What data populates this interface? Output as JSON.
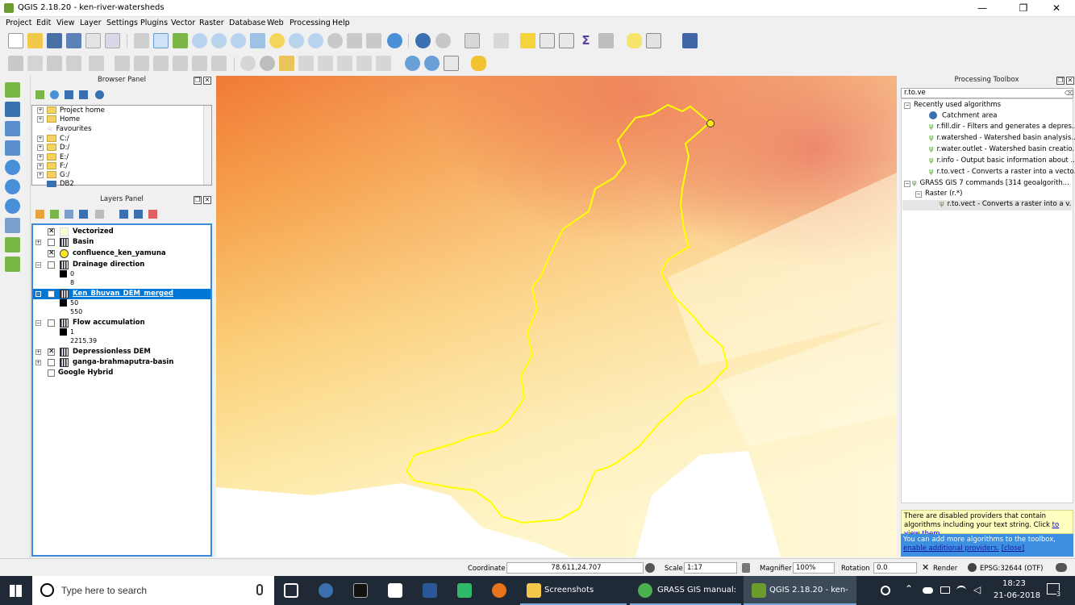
{
  "window": {
    "title": "QGIS 2.18.20 - ken-river-watersheds",
    "min": "—",
    "max": "❐",
    "close": "✕"
  },
  "menu": [
    "Project",
    "Edit",
    "View",
    "Layer",
    "Settings",
    "Plugins",
    "Vector",
    "Raster",
    "Database",
    "Web",
    "Processing",
    "Help"
  ],
  "browser": {
    "title": "Browser Panel",
    "items": [
      "Project home",
      "Home",
      "Favourites",
      "C:/",
      "D:/",
      "E:/",
      "F:/",
      "G:/",
      "DB2"
    ]
  },
  "layers": {
    "title": "Layers Panel",
    "rows": [
      {
        "name": "Vectorized",
        "checked": "✕"
      },
      {
        "name": "Basin",
        "checked": ""
      },
      {
        "name": "confluence_ken_yamuna",
        "checked": "✕"
      },
      {
        "name": "Drainage direction",
        "checked": "",
        "legend": [
          "0",
          "8"
        ]
      },
      {
        "name": "Ken_Bhuvan_DEM_merged",
        "checked": "",
        "legend": [
          "50",
          "550"
        ]
      },
      {
        "name": "Flow accumulation",
        "checked": "",
        "legend": [
          "1",
          "2215.39"
        ]
      },
      {
        "name": "Depressionless DEM",
        "checked": "✕"
      },
      {
        "name": "ganga-brahmaputra-basin",
        "checked": ""
      },
      {
        "name": "Google Hybrid",
        "checked": ""
      }
    ]
  },
  "toolbox": {
    "title": "Processing Toolbox",
    "search": "r.to.ve",
    "recent_header": "Recently used algorithms",
    "recent": [
      "Catchment area",
      "r.fill.dir - Filters and generates a depres...",
      "r.watershed - Watershed basin analysis...",
      "r.water.outlet - Watershed basin creatio...",
      "r.info - Output basic information about ...",
      "r.to.vect - Converts a raster into a vecto..."
    ],
    "grass_header": "GRASS GIS 7 commands [314 geoalgorith...",
    "raster_header": "Raster (r.*)",
    "raster_item": "r.to.vect - Converts a raster into a v...",
    "warn1_text": "There are disabled providers that contain algorithms including your text string. Click ",
    "warn1_link": "to view them.",
    "warn2_text": "You can add more algorithms to the toolbox, ",
    "warn2_link": "enable additional providers.",
    "warn2_close": "[close]"
  },
  "status": {
    "coord_label": "Coordinate",
    "coord_value": "78.611,24.707",
    "scale_label": "Scale",
    "scale_value": "1:17",
    "magnifier_label": "Magnifier",
    "magnifier_value": "100%",
    "rotation_label": "Rotation",
    "rotation_value": "0.0",
    "render_label": "Render",
    "crs": "EPSG:32644 (OTF)"
  },
  "taskbar": {
    "search": "Type here to search",
    "apps": [
      "Screenshots",
      "GRASS GIS manual: ...",
      "QGIS 2.18.20 - ken-r..."
    ],
    "time": "18:23",
    "date": "21-06-2018",
    "notif": "3"
  },
  "colors": {
    "accent": "#0078d7",
    "basin_outline": "#ffff00",
    "dem_high": "#e8502e",
    "dem_low": "#fff8c4",
    "taskbar": "#1f2a36"
  }
}
